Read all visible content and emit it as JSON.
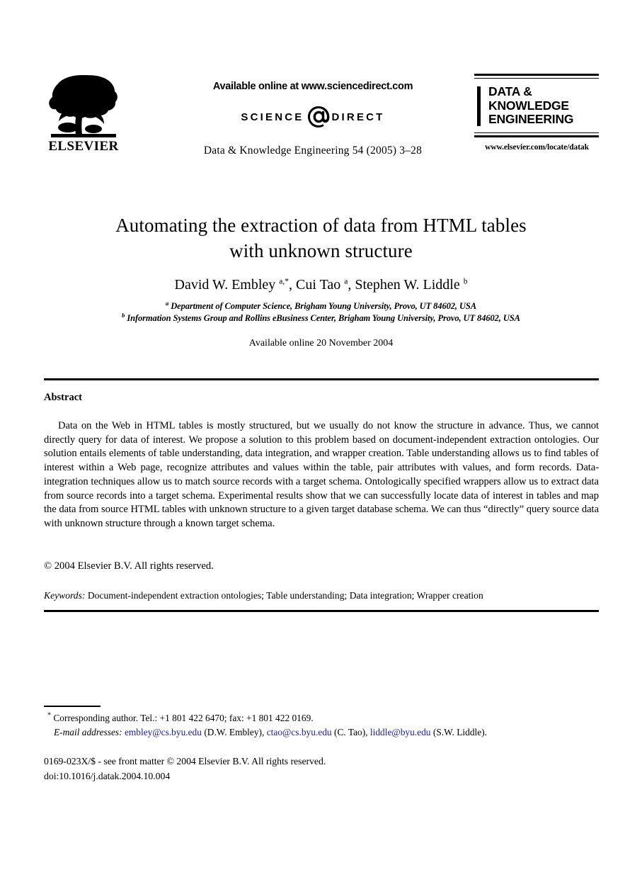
{
  "publisher": {
    "name": "ELSEVIER",
    "logo_icon": "elsevier-tree-icon"
  },
  "sciencedirect": {
    "available_line": "Available online at www.sciencedirect.com",
    "logo_science": "SCIENCE",
    "logo_at_icon": "at-sign-icon",
    "logo_direct": "DIRECT",
    "logo_trademark": "®"
  },
  "journal": {
    "citation_line": "Data & Knowledge Engineering 54 (2005) 3–28",
    "masthead_line1": "DATA &",
    "masthead_line2": "KNOWLEDGE",
    "masthead_line3": "ENGINEERING",
    "url": "www.elsevier.com/locate/datak"
  },
  "article": {
    "title_line1": "Automating the extraction of data from HTML tables",
    "title_line2": "with unknown structure",
    "authors_html": "David W. Embley <sup>a,*</sup>, Cui Tao <sup>a</sup>, Stephen W. Liddle <sup>b</sup>",
    "affiliation_a": "Department of Computer Science, Brigham Young University, Provo, UT 84602, USA",
    "affiliation_b": "Information Systems Group and Rollins eBusiness Center, Brigham Young University, Provo, UT 84602, USA",
    "available_online": "Available online 20 November 2004"
  },
  "abstract": {
    "heading": "Abstract",
    "text": "Data on the Web in HTML tables is mostly structured, but we usually do not know the structure in advance. Thus, we cannot directly query for data of interest. We propose a solution to this problem based on document-independent extraction ontologies. Our solution entails elements of table understanding, data integration, and wrapper creation. Table understanding allows us to find tables of interest within a Web page, recognize attributes and values within the table, pair attributes with values, and form records. Data-integration techniques allow us to match source records with a target schema. Ontologically specified wrappers allow us to extract data from source records into a target schema. Experimental results show that we can successfully locate data of interest in tables and map the data from source HTML tables with unknown structure to a given target database schema. We can thus “directly” query source data with unknown structure through a known target schema.",
    "copyright": "© 2004 Elsevier B.V. All rights reserved.",
    "keywords_label": "Keywords:",
    "keywords_text": "Document-independent extraction ontologies; Table understanding; Data integration; Wrapper creation"
  },
  "footnote": {
    "corresponding_marker": "*",
    "corresponding_text": "Corresponding author. Tel.: +1 801 422 6470; fax: +1 801 422 0169.",
    "email_label": "E-mail addresses:",
    "emails": [
      {
        "address": "embley@cs.byu.edu",
        "owner": "(D.W. Embley),"
      },
      {
        "address": "ctao@cs.byu.edu",
        "owner": "(C. Tao),"
      },
      {
        "address": "liddle@byu.edu",
        "owner": "(S.W. Liddle)."
      }
    ],
    "email_link_color": "#1a1a9c"
  },
  "imprint": {
    "line1": "0169-023X/$ - see front matter © 2004 Elsevier B.V. All rights reserved.",
    "line2": "doi:10.1016/j.datak.2004.10.004"
  }
}
